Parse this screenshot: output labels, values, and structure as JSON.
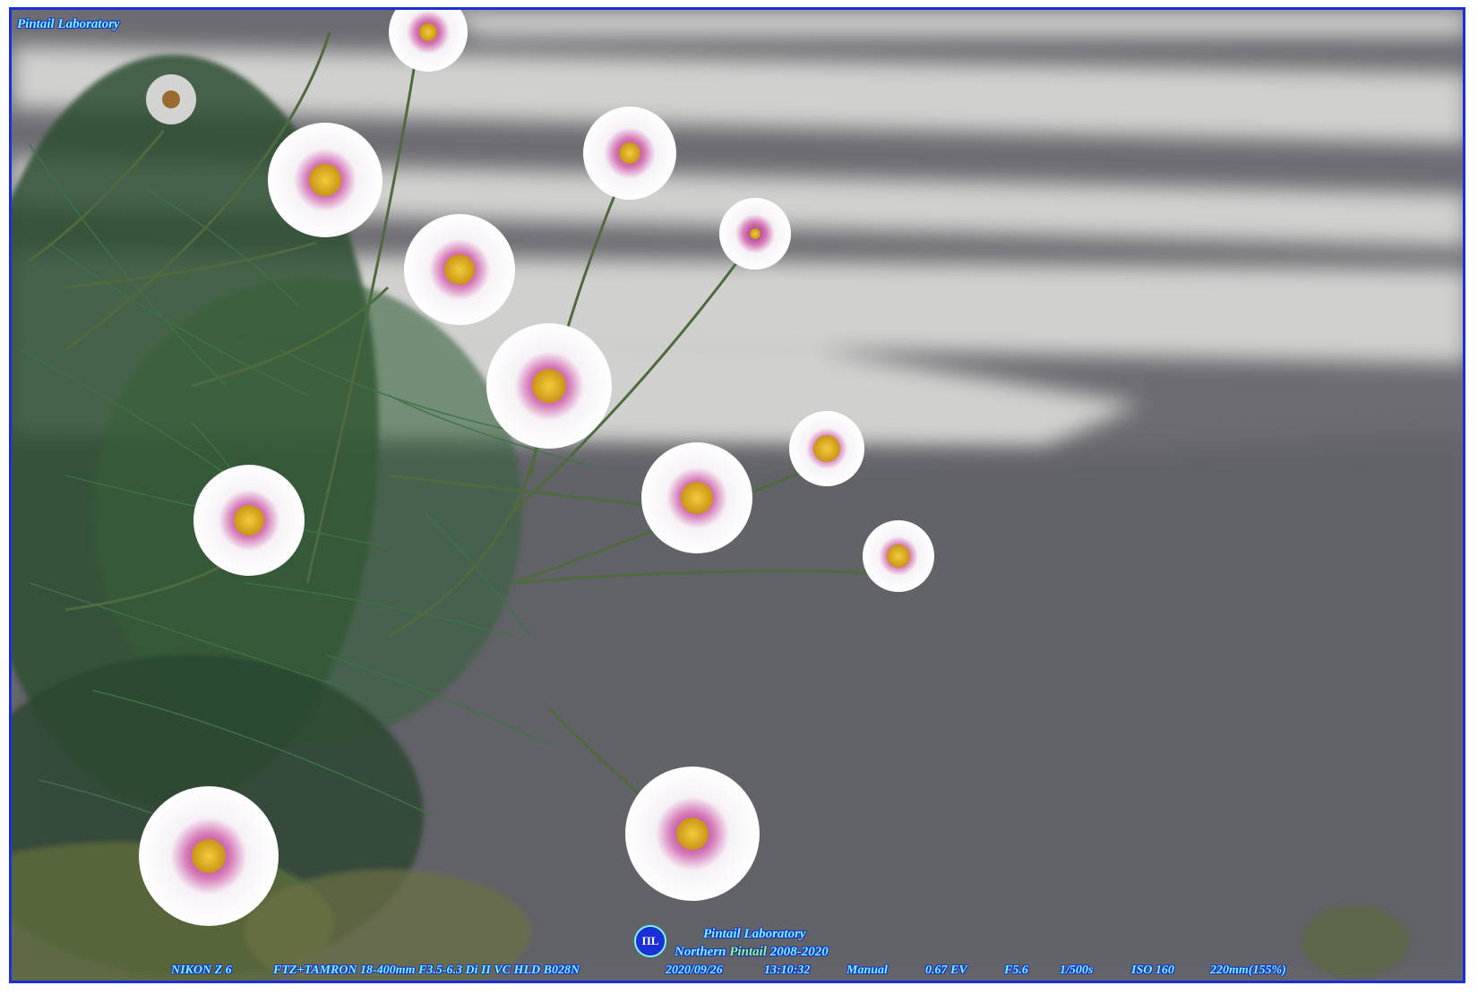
{
  "watermark": {
    "top_brand": "Pintail Laboratory",
    "bottom_brand": "Pintail Laboratory",
    "logo_glyph": "ΠL",
    "tagline_prefix": "Northern ",
    "tagline_highlight": "Pintail",
    "tagline_years": " 2008-2020"
  },
  "exif": {
    "camera": "NIKON Z 6",
    "lens": "FTZ+TAMRON 18-400mm F3.5-6.3 Di II VC HLD B028N",
    "date": "2020/09/26",
    "time": "13:10:32",
    "mode": "Manual",
    "ev": "0.67 EV",
    "aperture": "F5.6",
    "shutter": "1/500s",
    "iso": "ISO 160",
    "focal": "220mm(155%)"
  },
  "colors": {
    "frame_border": "#1a2fd6",
    "overlay_text": "#7af7ff",
    "asphalt": "#6d6d73",
    "crosswalk": "#d4d4d2",
    "foliage": "#2f5a34",
    "petal": "#f6f4f6",
    "petal_accent": "#b83a8e",
    "flower_center": "#e2b524"
  }
}
